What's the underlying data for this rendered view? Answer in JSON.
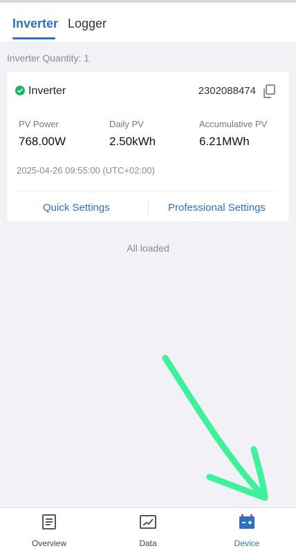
{
  "tabs": {
    "inverter": "Inverter",
    "logger": "Logger"
  },
  "inverter_quantity": "Inverter Quantity: 1",
  "card": {
    "name": "Inverter",
    "serial": "2302088474",
    "status": "online",
    "metrics": [
      {
        "label": "PV Power",
        "value": "768.00W"
      },
      {
        "label": "Daily PV",
        "value": "2.50kWh"
      },
      {
        "label": "Accumulative PV",
        "value": "6.21MWh"
      }
    ],
    "timestamp": "2025-04-26 09:55:00 (UTC+02:00)",
    "actions": {
      "quick": "Quick Settings",
      "professional": "Professional Settings"
    }
  },
  "list_status": "All loaded",
  "bottom_nav": {
    "overview": "Overview",
    "data": "Data",
    "device": "Device",
    "active": "device"
  },
  "colors": {
    "accent": "#2f6fc4",
    "status_ok": "#1db36b",
    "annotation_arrow": "#3df29a"
  },
  "icons": [
    "check-circle-icon",
    "copy-icon",
    "overview-icon",
    "data-chart-icon",
    "device-icon",
    "arrow-annotation"
  ]
}
